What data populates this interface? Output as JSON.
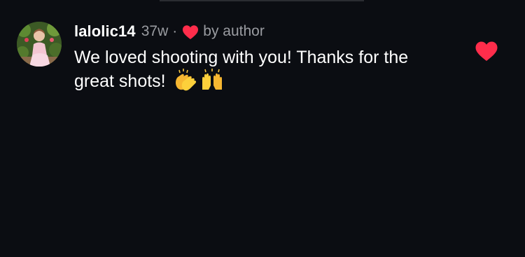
{
  "comment": {
    "username": "lalolic14",
    "time_ago": "37w",
    "separator": "·",
    "author_label": "by author",
    "text": "We loved shooting with you! Thanks for the great shots!",
    "emojis": [
      "clapping-hands",
      "raising-hands"
    ],
    "liked": true
  },
  "colors": {
    "background": "#0b0d12",
    "heart": "#ff2d4b",
    "muted_text": "#9a9ca1",
    "primary_text": "#ffffff"
  }
}
